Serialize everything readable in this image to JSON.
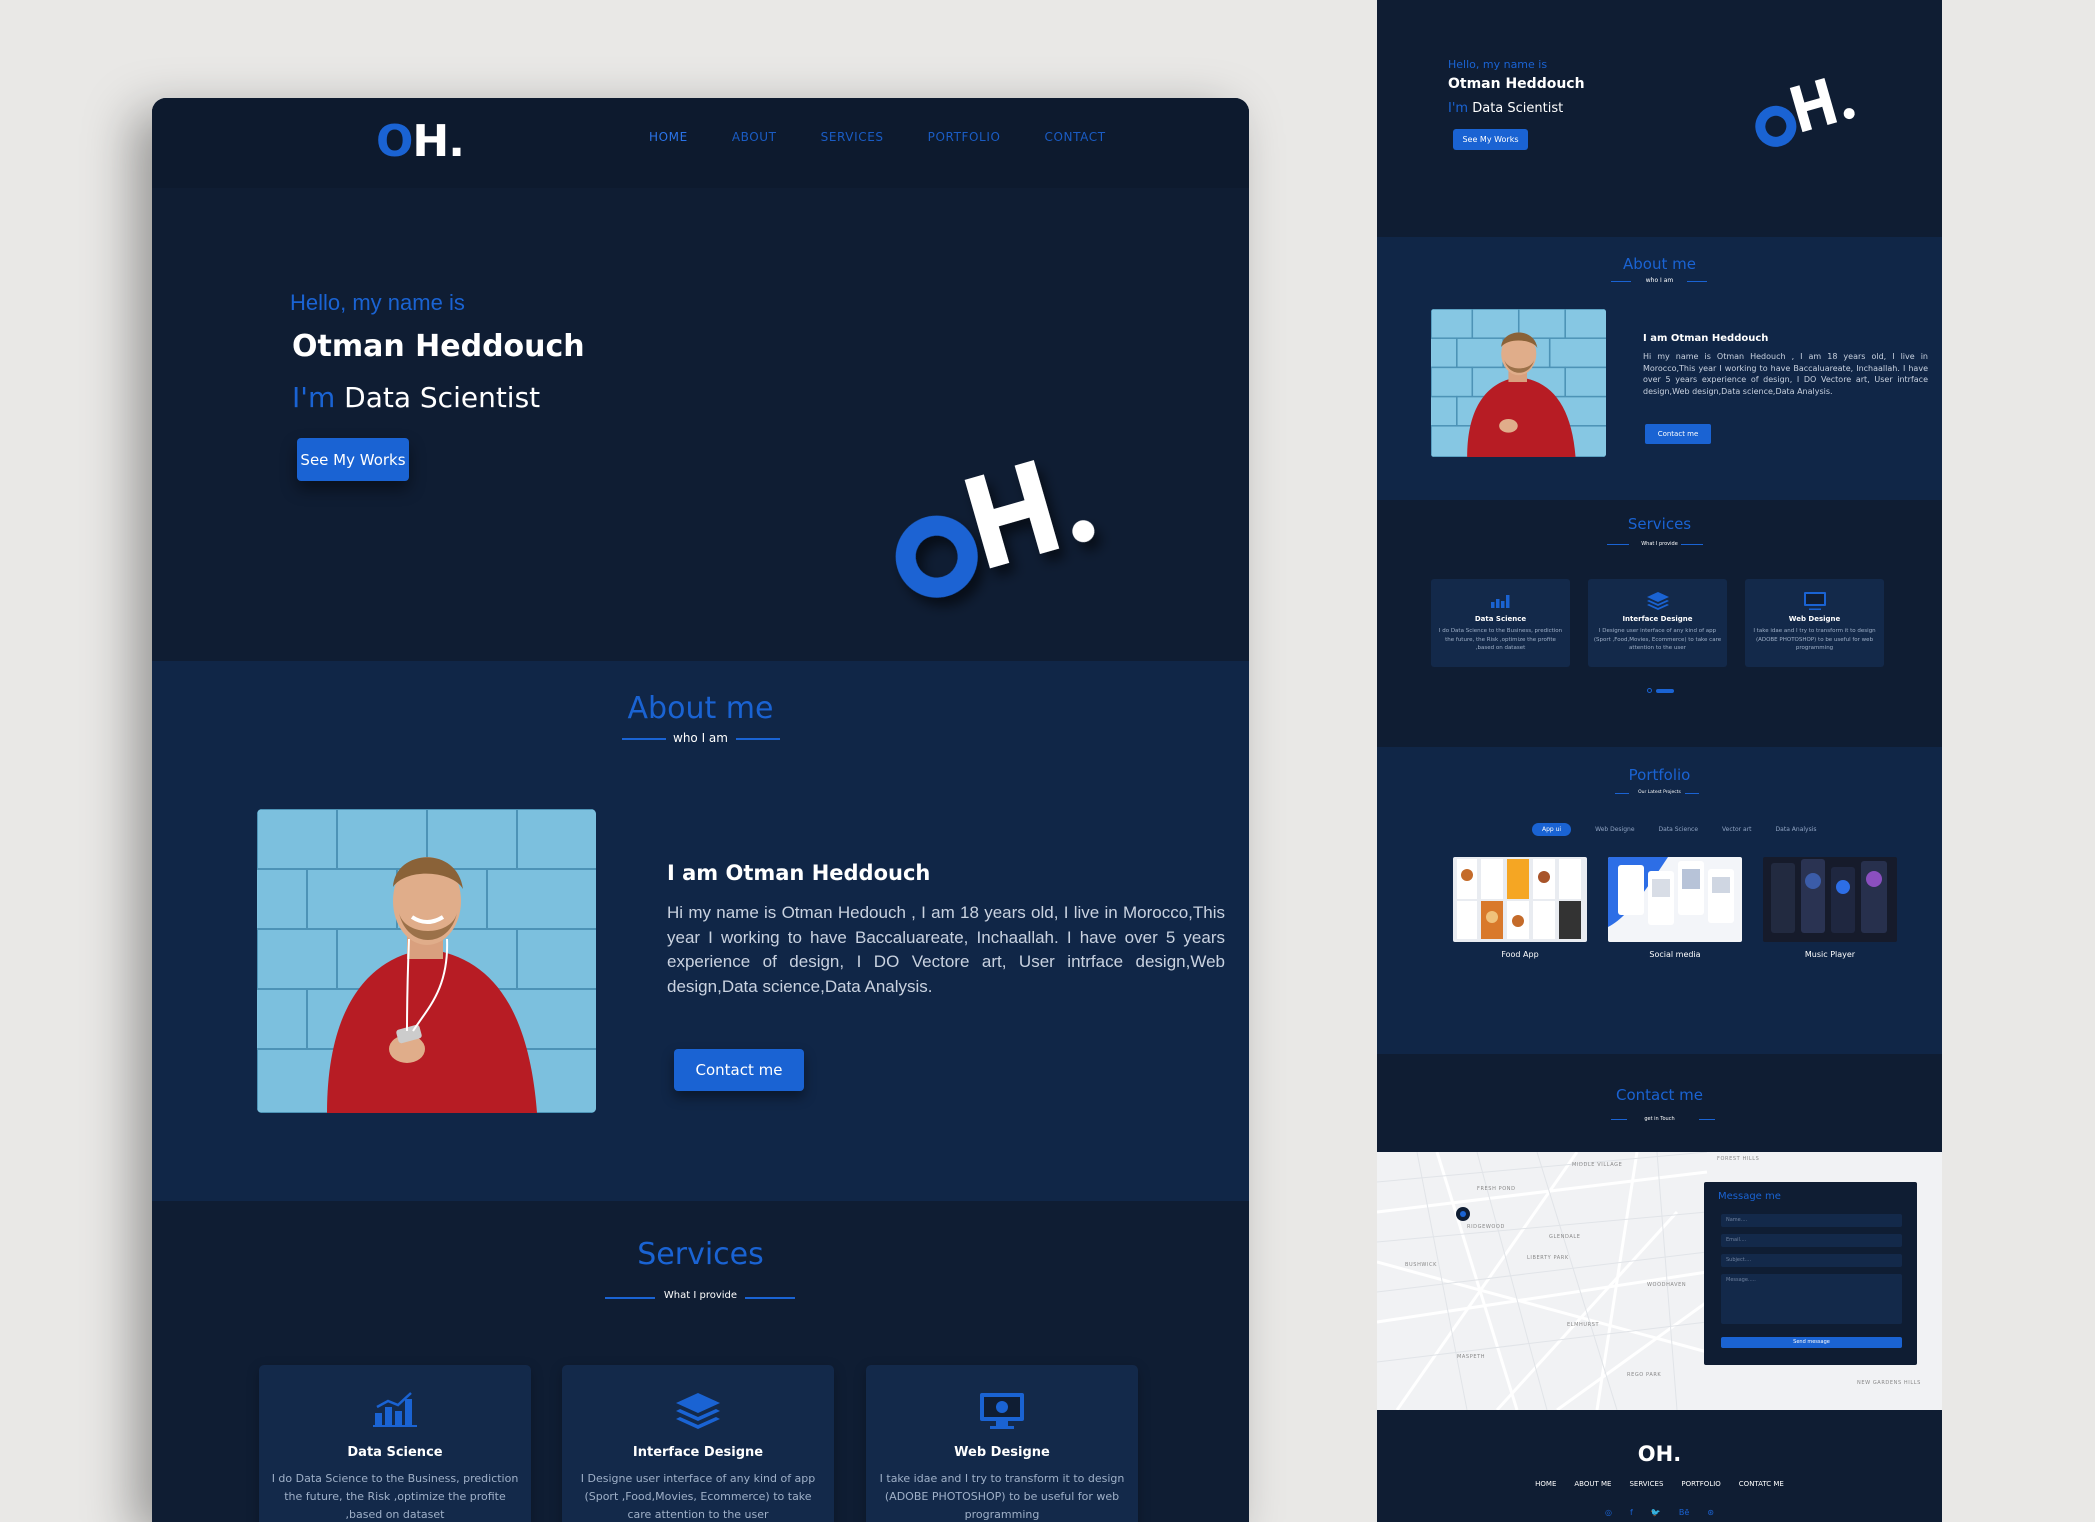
{
  "colors": {
    "accent": "#1a63d3",
    "bg": "#0f1d33",
    "section_alt": "#102647",
    "card": "#13294a",
    "frame": "#e9e8e6"
  },
  "nav": {
    "logo_o": "O",
    "logo_rest": "H.",
    "links": [
      {
        "label": "HOME"
      },
      {
        "label": "ABOUT"
      },
      {
        "label": "SERVICES"
      },
      {
        "label": "PORTFOLIO"
      },
      {
        "label": "CONTACT"
      }
    ]
  },
  "hero": {
    "hello": "Hello, my name is",
    "name": "Otman Heddouch",
    "role_prefix": "I'm",
    "role": "Data Scientist",
    "button": "See My Works",
    "big_logo": "OH."
  },
  "about": {
    "title": "About me",
    "subtitle": "who I am",
    "heading": "I am Otman Heddouch",
    "text": "Hi my name is Otman Hedouch , I am 18 years old, I live in Morocco,This year I working to have Baccaluareate, Inchaallah. I have over 5 years experience of design, I DO Vectore art, User intrface design,Web design,Data science,Data Analysis.",
    "button": "Contact me"
  },
  "services": {
    "title": "Services",
    "subtitle": "What I provide",
    "cards": [
      {
        "icon": "chart-icon",
        "title": "Data Science",
        "desc": "I do Data Science to the Business, prediction the future, the Risk ,optimize the profite ,based on dataset"
      },
      {
        "icon": "layers-icon",
        "title": "Interface Designe",
        "desc": "I Designe user interface of any kind of app (Sport ,Food,Movies, Ecommerce) to take care attention to the user"
      },
      {
        "icon": "monitor-icon",
        "title": "Web Designe",
        "desc": "I take idae and I try to transform it to design (ADOBE PHOTOSHOP) to be useful for web programming"
      }
    ]
  },
  "side": {
    "hello": "Hello, my name is",
    "name": "Otman Heddouch",
    "role_prefix": "I'm",
    "role": "Data Scientist",
    "button": "See My Works",
    "about": {
      "title": "About me",
      "subtitle": "who I am",
      "heading": "I am Otman Heddouch",
      "text": "Hi my name is Otman Hedouch , I am 18 years old, I live in Morocco,This year I working to have Baccaluareate, Inchaallah. I have over 5 years experience of design, I DO Vectore art, User intrface design,Web design,Data science,Data Analysis.",
      "button": "Contact me"
    },
    "services": {
      "title": "Services",
      "subtitle": "What I provide"
    },
    "portfolio": {
      "title": "Portfolio",
      "subtitle": "Our Latest Projects",
      "filters": [
        {
          "label": "App ui"
        },
        {
          "label": "Web Designe"
        },
        {
          "label": "Data Science"
        },
        {
          "label": "Vector art"
        },
        {
          "label": "Data Analysis"
        }
      ],
      "items": [
        {
          "caption": "Food App"
        },
        {
          "caption": "Social media"
        },
        {
          "caption": "Music Player"
        }
      ]
    },
    "contact": {
      "title": "Contact me",
      "subtitle": "get in Touch",
      "message_title": "Message me",
      "name_ph": "Name....",
      "email_ph": "Email....",
      "subject_ph": "Subject....",
      "message_ph": "Message.....",
      "send": "Send message",
      "map_labels": [
        "MIDDLE VILLAGE",
        "FOREST HILLS",
        "FRESH POND",
        "RIDGEWOOD",
        "GLENDALE",
        "LIBERTY PARK",
        "BUSHWICK",
        "WOODHAVEN",
        "ELMHURST",
        "MASPETH",
        "REGO PARK",
        "NEW GARDENS HILLS"
      ]
    },
    "footer": {
      "logo": "OH.",
      "links": [
        {
          "label": "HOME"
        },
        {
          "label": "ABOUT ME"
        },
        {
          "label": "SERVICES"
        },
        {
          "label": "PORTFOLIO"
        },
        {
          "label": "CONTATC ME"
        }
      ],
      "social": [
        {
          "label": "◎"
        },
        {
          "label": "f"
        },
        {
          "label": "🐦"
        },
        {
          "label": "Bē"
        },
        {
          "label": "⊛"
        }
      ]
    }
  }
}
